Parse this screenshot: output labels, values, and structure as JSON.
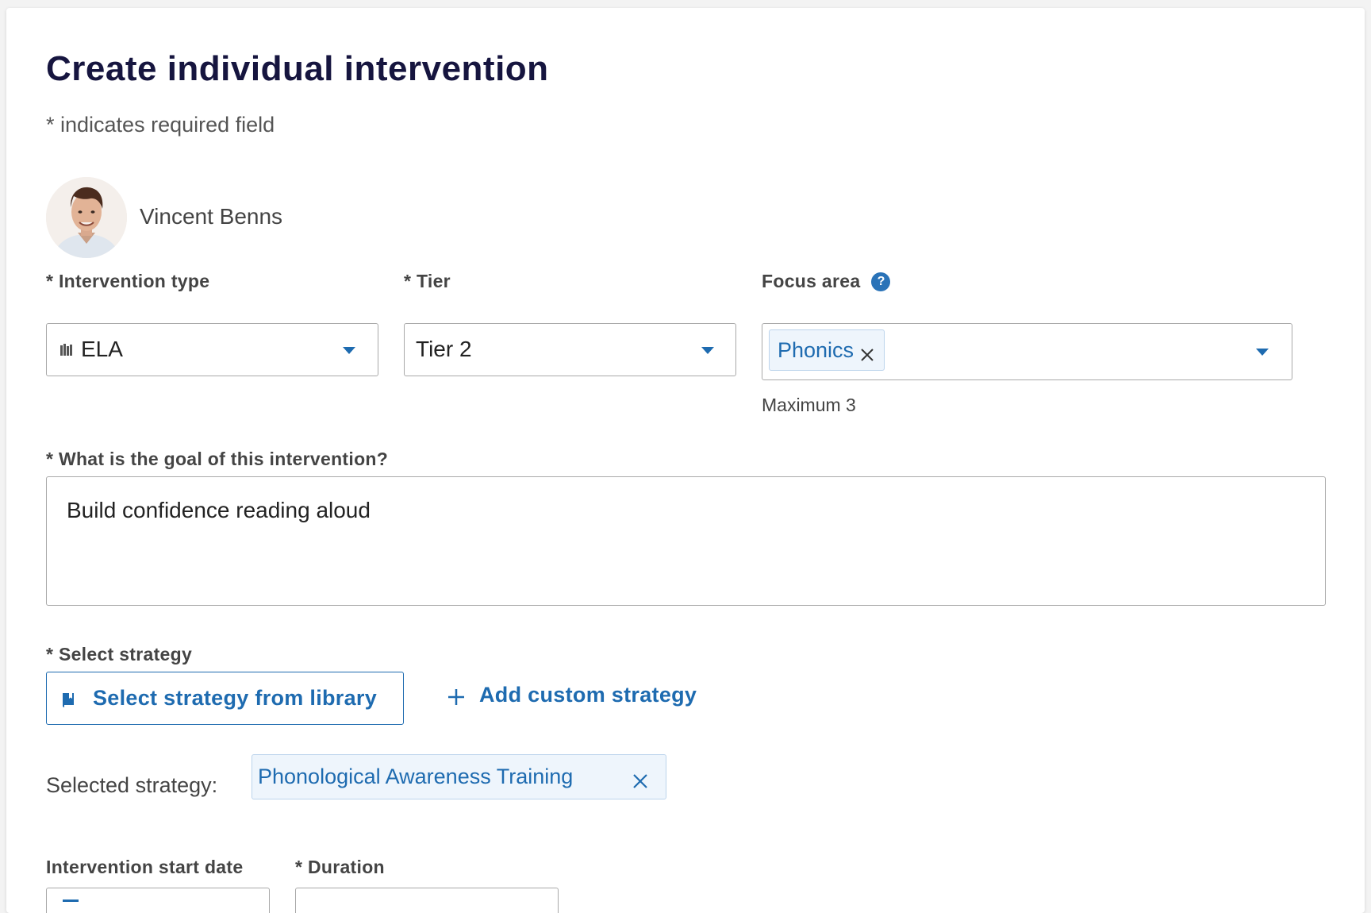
{
  "form": {
    "title": "Create individual intervention",
    "required_note": "* indicates required field"
  },
  "student": {
    "name": "Vincent Benns"
  },
  "fields": {
    "intervention_type": {
      "label": "* Intervention type",
      "value": "ELA",
      "icon": "books-icon"
    },
    "tier": {
      "label": "* Tier",
      "value": "Tier 2"
    },
    "focus_area": {
      "label": "Focus area",
      "help_icon": "?",
      "chips": [
        "Phonics"
      ],
      "helper": "Maximum 3"
    },
    "goal": {
      "label": "* What is the goal of this intervention?",
      "value": "Build confidence reading aloud"
    },
    "strategy": {
      "label": "* Select strategy",
      "library_button": "Select strategy from library",
      "custom_button": "Add custom strategy",
      "selected_label": "Selected strategy:",
      "selected_value": "Phonological Awareness Training"
    },
    "start_date": {
      "label": "Intervention start date"
    },
    "duration": {
      "label": "* Duration"
    }
  },
  "colors": {
    "title": "#16153f",
    "accent": "#1e6bb0",
    "chip_bg": "#eef5fc"
  }
}
